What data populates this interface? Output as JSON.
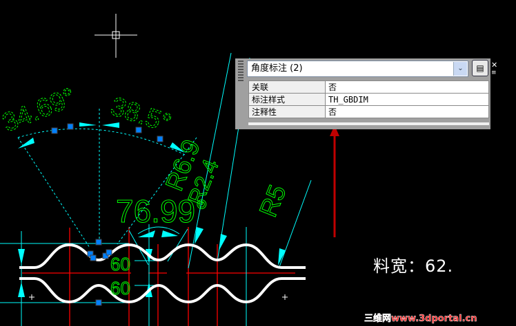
{
  "properties_panel": {
    "selection": "角度标注 (2)",
    "rows": [
      {
        "label": "关联",
        "value": "否"
      },
      {
        "label": "标注样式",
        "value": "TH_GBDIM"
      },
      {
        "label": "注释性",
        "value": "否"
      }
    ],
    "quick_select_icon": "quick-select-icon",
    "close_icon": "close-icon",
    "menu_icon": "menu-icon"
  },
  "drawing": {
    "dimensions": {
      "angle_left": "34.69°",
      "angle_right": "38.5°",
      "angle_total": "76.99°",
      "radius_a": "R6.9",
      "radius_b": "R2.4",
      "radius_c": "R5",
      "pitch_top": "60",
      "pitch_bottom": "60"
    },
    "note": "料宽：62.",
    "colors": {
      "geometry": "#ffffff",
      "dimension_text": "#00ff00",
      "dimension_lines": "#00ffff",
      "centerline": "#ff0000",
      "grip": "#0080ff"
    }
  },
  "watermark": "三维网www.3dportal.cn"
}
